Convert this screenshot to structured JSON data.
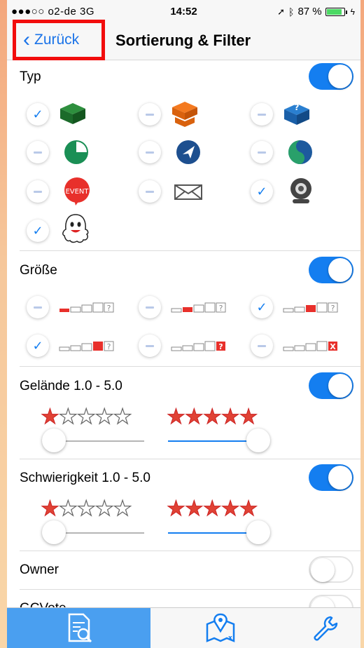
{
  "status": {
    "carrier": "●●●○○ o2-de  3G",
    "time": "14:52",
    "battery": "87 %",
    "battery_level": 0.87
  },
  "nav": {
    "back_label": "Zurück",
    "title": "Sortierung & Filter"
  },
  "sections": {
    "typ": {
      "label": "Typ",
      "enabled": true
    },
    "groesse": {
      "label": "Größe",
      "enabled": true
    },
    "gelaende": {
      "label": "Gelände 1.0 - 5.0",
      "enabled": true,
      "min": 1.0,
      "max": 5.0
    },
    "schwierigkeit": {
      "label": "Schwierigkeit 1.0 - 5.0",
      "enabled": true,
      "min": 1.0,
      "max": 5.0
    },
    "owner": {
      "label": "Owner",
      "enabled": false
    },
    "gcvote": {
      "label": "GCVote",
      "enabled": false
    }
  },
  "typ_items": [
    {
      "icon": "traditional-cache-icon",
      "checked": true
    },
    {
      "icon": "multi-cache-icon",
      "checked": false
    },
    {
      "icon": "mystery-cache-icon",
      "checked": false
    },
    {
      "icon": "earthcache-pie-icon",
      "checked": false
    },
    {
      "icon": "virtual-cache-icon",
      "checked": false
    },
    {
      "icon": "webcam-globe-icon",
      "checked": false
    },
    {
      "icon": "event-icon",
      "checked": false
    },
    {
      "icon": "letterbox-icon",
      "checked": false
    },
    {
      "icon": "webcam-icon",
      "checked": true
    },
    {
      "icon": "ghost-icon",
      "checked": true
    }
  ],
  "event_label": "EVENT",
  "size_items": [
    {
      "icon": "size-micro-icon",
      "checked": false
    },
    {
      "icon": "size-small-icon",
      "checked": false
    },
    {
      "icon": "size-regular-icon",
      "checked": true
    },
    {
      "icon": "size-large-icon",
      "checked": true
    },
    {
      "icon": "size-other-icon",
      "checked": false
    },
    {
      "icon": "size-not-chosen-icon",
      "checked": false
    }
  ],
  "colors": {
    "accent": "#147ef0",
    "star": "#e04235",
    "highlight": "#f20d0d"
  },
  "tabs": [
    {
      "icon": "list-search-icon",
      "active": true
    },
    {
      "icon": "map-pin-icon",
      "active": false
    },
    {
      "icon": "wrench-icon",
      "active": false
    }
  ]
}
